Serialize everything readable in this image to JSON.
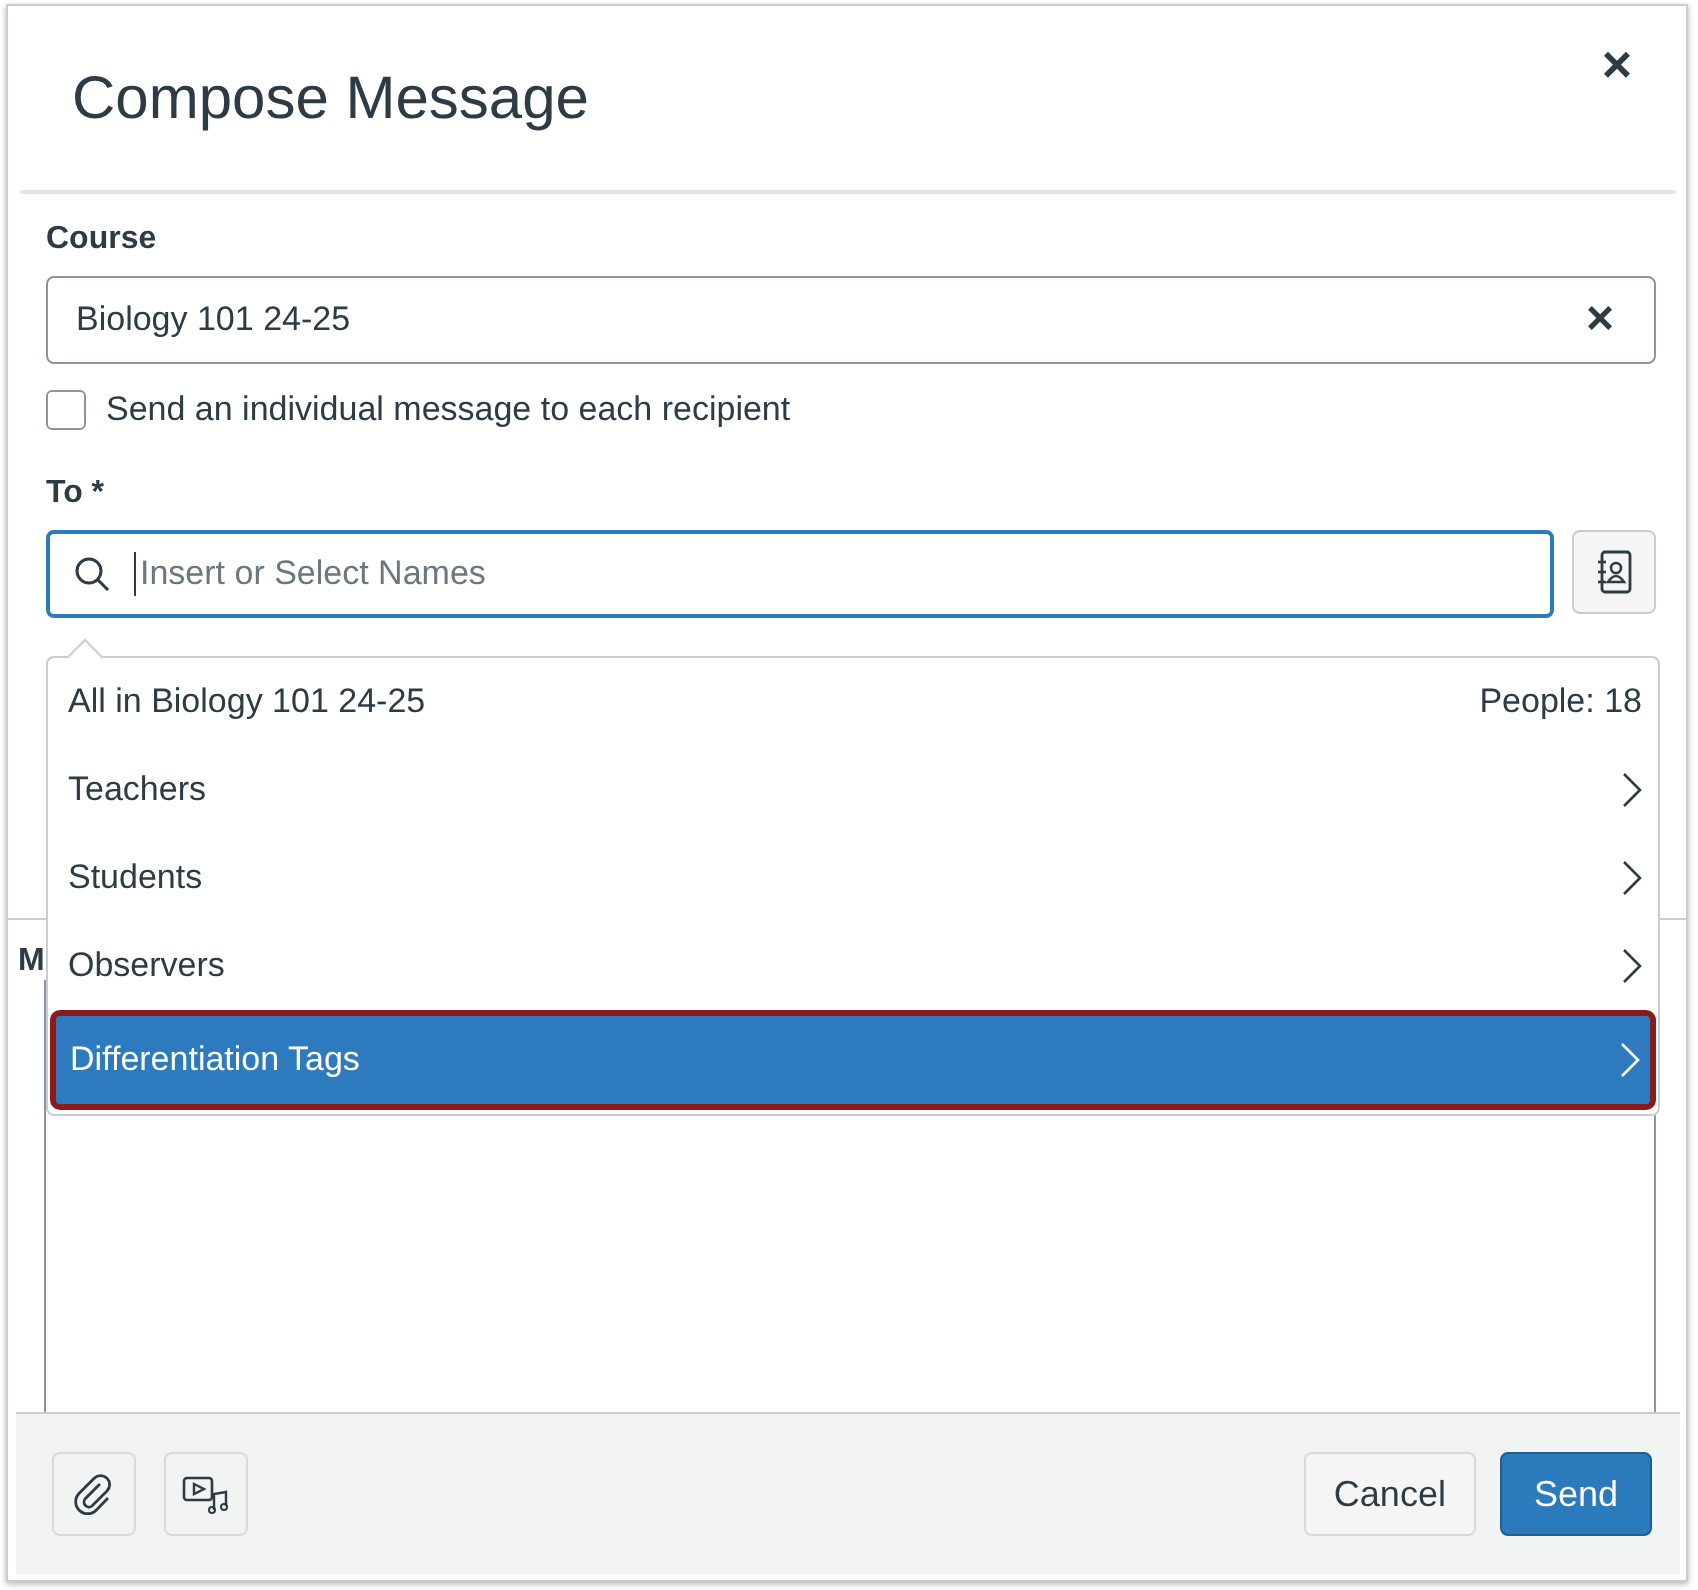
{
  "dialog": {
    "title": "Compose Message",
    "close": "×"
  },
  "course": {
    "label": "Course",
    "value": "Biology 101 24-25",
    "clear": "×"
  },
  "individual": {
    "label": "Send an individual message to each recipient",
    "checked": false
  },
  "to": {
    "label": "To *",
    "placeholder": "Insert or Select Names"
  },
  "message_label": "M",
  "dropdown": {
    "items": [
      {
        "kind": "header",
        "label": "All in Biology 101 24-25",
        "count": "People: 18",
        "selected": false
      },
      {
        "kind": "group",
        "label": "Teachers",
        "selected": false
      },
      {
        "kind": "group",
        "label": "Students",
        "selected": false
      },
      {
        "kind": "group",
        "label": "Observers",
        "selected": false
      },
      {
        "kind": "group",
        "label": "Differentiation Tags",
        "selected": true
      }
    ]
  },
  "footer": {
    "cancel": "Cancel",
    "send": "Send"
  }
}
